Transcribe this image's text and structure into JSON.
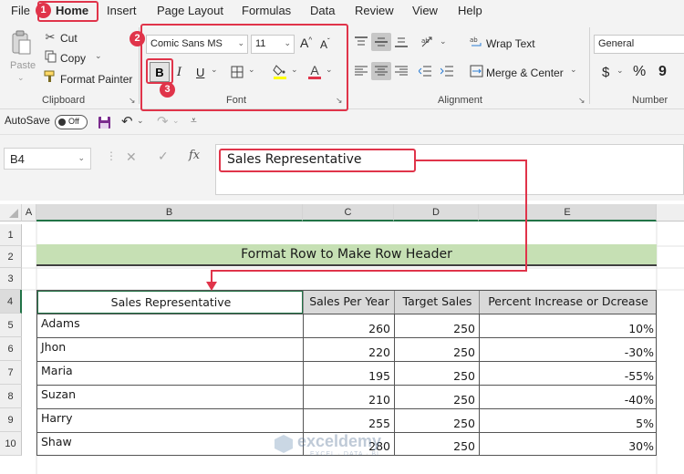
{
  "ribbon_tabs": [
    "File",
    "Home",
    "Insert",
    "Page Layout",
    "Formulas",
    "Data",
    "Review",
    "View",
    "Help"
  ],
  "clipboard": {
    "paste": "Paste",
    "cut": "Cut",
    "copy": "Copy",
    "format_painter": "Format Painter",
    "label": "Clipboard"
  },
  "font": {
    "name": "Comic Sans MS",
    "size": "11",
    "label": "Font",
    "bold": "B",
    "italic": "I",
    "underline": "U",
    "color_letter": "A",
    "grow": "A",
    "shrink": "A"
  },
  "alignment": {
    "wrap_text": "Wrap Text",
    "merge_center": "Merge & Center",
    "label": "Alignment"
  },
  "number": {
    "format": "General",
    "currency": "$",
    "percent": "%",
    "comma": "9",
    "label": "Number"
  },
  "qat": {
    "autosave": "AutoSave",
    "toggle": "Off"
  },
  "formula_bar": {
    "name_box": "B4",
    "fx": "fx",
    "content": "Sales Representative"
  },
  "columns": [
    "A",
    "B",
    "C",
    "D",
    "E"
  ],
  "rows": [
    "1",
    "2",
    "3",
    "4",
    "5",
    "6",
    "7",
    "8",
    "9",
    "10"
  ],
  "sheet": {
    "title": "Format Row to Make Row Header",
    "headers": [
      "Sales Representative",
      "Sales Per Year",
      "Target Sales",
      "Percent Increase or Dcrease"
    ],
    "data": [
      [
        "Adams",
        "260",
        "250",
        "10%"
      ],
      [
        "Jhon",
        "220",
        "250",
        "-30%"
      ],
      [
        "Maria",
        "195",
        "250",
        "-55%"
      ],
      [
        "Suzan",
        "210",
        "250",
        "-40%"
      ],
      [
        "Harry",
        "255",
        "250",
        "5%"
      ],
      [
        "Shaw",
        "280",
        "250",
        "30%"
      ]
    ]
  },
  "badges": [
    "1",
    "2",
    "3"
  ],
  "watermark": {
    "name": "exceldemy",
    "tagline": "EXCEL · DATA · BI"
  },
  "colors": {
    "accent_red": "#e0344a",
    "title_fill": "#c6e0b4",
    "header_fill": "#d9d9d9",
    "excel_green": "#217346"
  }
}
